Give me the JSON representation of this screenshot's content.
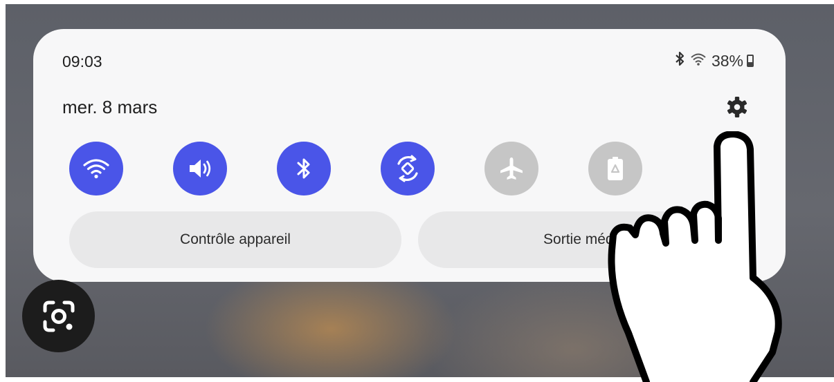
{
  "status_bar": {
    "time": "09:03",
    "battery_percent": "38%",
    "icons": [
      "bluetooth-icon",
      "wifi-icon",
      "battery-icon"
    ]
  },
  "header": {
    "date": "mer. 8 mars",
    "settings_icon": "gear-icon"
  },
  "quick_toggles": [
    {
      "name": "wifi",
      "icon": "wifi-icon",
      "state": "on"
    },
    {
      "name": "sound",
      "icon": "sound-icon",
      "state": "on"
    },
    {
      "name": "bluetooth",
      "icon": "bluetooth-icon",
      "state": "on"
    },
    {
      "name": "auto-rotate",
      "icon": "auto-rotate-icon",
      "state": "on"
    },
    {
      "name": "airplane-mode",
      "icon": "airplane-icon",
      "state": "off"
    },
    {
      "name": "power-saving",
      "icon": "battery-saver-icon",
      "state": "off"
    }
  ],
  "buttons": {
    "device_control": "Contrôle appareil",
    "media_output": "Sortie média"
  },
  "colors": {
    "accent": "#4a55e8",
    "inactive": "#c6c6c6",
    "panel": "#f7f7f8",
    "pill": "#e8e8e9"
  },
  "overlay": {
    "lens_icon": "google-lens-icon",
    "pointer_icon": "pointing-hand-icon"
  }
}
